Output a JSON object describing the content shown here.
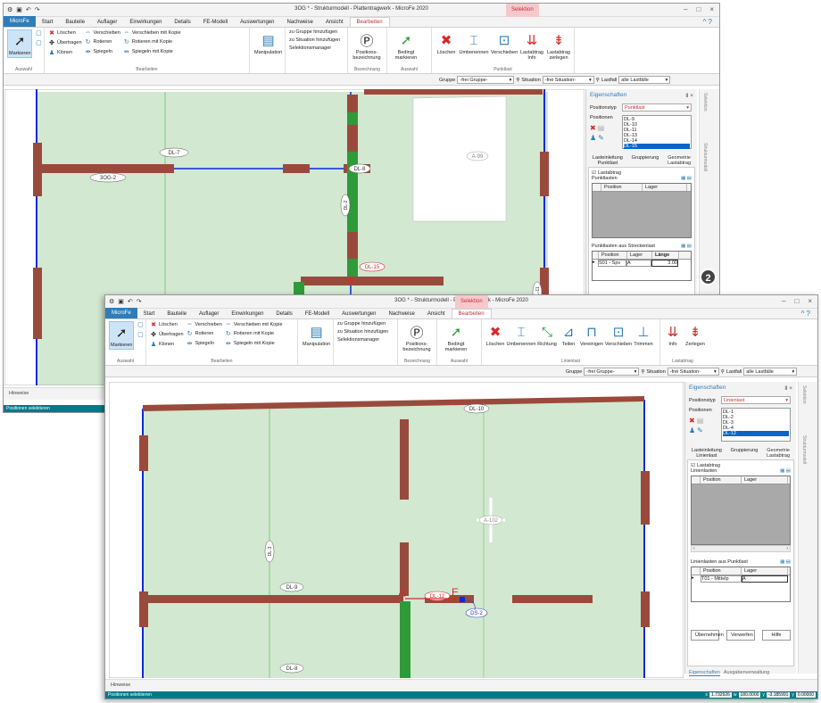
{
  "back": {
    "title": "3OG * - Strukturmodell - Plattentragwerk - MicroFe 2020",
    "context_tab": "Selektion",
    "tabs": [
      "MicroFe",
      "Start",
      "Bauteile",
      "Auflager",
      "Einwirkungen",
      "Details",
      "FE-Modell",
      "Auswertungen",
      "Nachweise",
      "Ansicht",
      "Bearbeiten"
    ],
    "ribbon": {
      "markieren": "Markieren",
      "auswahl": "Auswahl",
      "loeschen": "Löschen",
      "uebertragen": "Übertragen",
      "klonen": "Klonen",
      "verschieben": "Verschieben",
      "rotieren": "Rotieren",
      "spiegeln": "Spiegeln",
      "verschieben_kopie": "Verschieben mit Kopie",
      "rotieren_kopie": "Rotieren mit Kopie",
      "spiegeln_kopie": "Spiegeln mit Kopie",
      "bearbeiten": "Bearbeiten",
      "manipulation": "Manipulation",
      "gruppe": "zu Gruppe hinzufügen",
      "situation": "zu Situation hinzufügen",
      "selmanager": "Selektionsmanager",
      "posbez": "Positions-\nbezeichnung",
      "bezeichnung": "Bezeichnung",
      "bedingt": "Bedingt\nmarkieren",
      "auswahl2": "Auswahl",
      "loeschen2": "Löschen",
      "umbenennen": "Umbenennen",
      "verschieben2": "Verschieben",
      "lastabtrag_info": "Lastabtrag\nInfo",
      "lastabtrag_zerlegen": "Lastabtrag\nzerlegen",
      "punktlast": "Punktlast"
    },
    "filter": {
      "gruppe_label": "Gruppe",
      "gruppe": "-frei Gruppe-",
      "situation_label": "Situation",
      "situation": "-frei Situation-",
      "lastfall_label": "Lastfall",
      "lastfall": "alle Lastfälle"
    },
    "panel": {
      "title": "Eigenschaften",
      "pin": "Ⅱ ×",
      "positionstyp_label": "Positionstyp",
      "positionstyp": "Punktlast",
      "positionen_label": "Positionen",
      "positionen": [
        "DL-9",
        "DL-10",
        "DL-11",
        "DL-13",
        "DL-14",
        "DL-15"
      ],
      "selected_index": 5,
      "subtabs": [
        "Lasteinleitung\nPunktlast",
        "Gruppierung",
        "Geometrie\nLastabtrag"
      ],
      "lastabtrag_check": "Lastabtrag",
      "grid_label": "Punktlasten",
      "col_position": "Position",
      "col_lager": "Lager",
      "strecken_label": "Punktlasten aus Streckenlast",
      "col_laenge": "Länge",
      "row_position": "S01 - Spv",
      "row_lager": "A",
      "row_laenge": "3.00"
    },
    "sidebar": [
      "Selektion",
      "Strukturmodell"
    ],
    "hinweise": "Hinweise",
    "status": "Positionen selektieren",
    "canvas_labels": [
      "DL-7",
      "3OG-2",
      "DL-8",
      "DL-15",
      "DL-2",
      "A-99",
      "DL-11"
    ]
  },
  "front": {
    "title": "3OG * - Strukturmodell - Plattentragwerk - MicroFe 2020",
    "context_tab": "Selektion",
    "tabs": [
      "MicroFe",
      "Start",
      "Bauteile",
      "Auflager",
      "Einwirkungen",
      "Details",
      "FE-Modell",
      "Auswertungen",
      "Nachweise",
      "Ansicht",
      "Bearbeiten"
    ],
    "ribbon": {
      "markieren": "Markieren",
      "auswahl": "Auswahl",
      "loeschen": "Löschen",
      "uebertragen": "Übertragen",
      "klonen": "Klonen",
      "verschieben": "Verschieben",
      "rotieren": "Rotieren",
      "spiegeln": "Spiegeln",
      "verschieben_kopie": "Verschieben mit Kopie",
      "rotieren_kopie": "Rotieren mit Kopie",
      "spiegeln_kopie": "Spiegeln mit Kopie",
      "bearbeiten": "Bearbeiten",
      "manipulation": "Manipulation",
      "gruppe": "zu Gruppe hinzufügen",
      "situation": "zu Situation hinzufügen",
      "selmanager": "Selektionsmanager",
      "posbez": "Positions-\nbezeichnung",
      "bezeichnung": "Bezeichnung",
      "bedingt": "Bedingt\nmarkieren",
      "auswahl2": "Auswahl",
      "loeschen2": "Löschen",
      "umbenennen": "Umbenennen",
      "richtung": "Richtung",
      "teilen": "Teilen",
      "vereinigen": "Vereinigen",
      "verschieben2": "Verschieben",
      "trimmen": "Trimmen",
      "linienlast": "Linienlast",
      "info": "Info",
      "zerlegen": "Zerlegen",
      "lastabtrag": "Lastabtrag"
    },
    "filter": {
      "gruppe_label": "Gruppe",
      "gruppe": "-frei Gruppe-",
      "situation_label": "Situation",
      "situation": "-frei Situation-",
      "lastfall_label": "Lastfall",
      "lastfall": "alle Lastfälle"
    },
    "panel": {
      "title": "Eigenschaften",
      "pin": "Ⅱ ×",
      "positionstyp_label": "Positionstyp",
      "positionstyp": "Linienlast",
      "positionen_label": "Positionen",
      "positionen": [
        "DL-1",
        "DL-2",
        "DL-3",
        "DL-4",
        "DL-12"
      ],
      "selected_index": 4,
      "subtabs": [
        "Lasteinleitung\nLinienlast",
        "Gruppierung",
        "Geometrie\nLastabtrag"
      ],
      "lastabtrag_check": "Lastabtrag",
      "grid_label": "Linienlasten",
      "col_position": "Position",
      "col_lager": "Lager",
      "punkt_label": "Linienlasten aus Punktlast",
      "row_position": "T01 - Mittelp",
      "row_lager": "A",
      "btn_uebernehmen": "Übernehmen",
      "btn_verwerfen": "Verwerfen",
      "btn_hilfe": "Hilfe",
      "bottom_tabs": [
        "Eigenschaften",
        "Ausgabenverwaltung"
      ]
    },
    "sidebar": [
      "Selektion",
      "Strukturmodell"
    ],
    "hinweise": "Hinweise",
    "status": "Positionen selektieren",
    "coords": {
      "x_label": "x",
      "x": "1.732926",
      "w_label": "w",
      "w": "180.0000",
      "y_label": "y",
      "y": "-3.185991",
      "z_label": "y",
      "z": "0.00000"
    },
    "canvas_labels": {
      "dl10": "DL-10",
      "dl3": "DL-3",
      "dl9": "DL-9",
      "dl12": "DL-12",
      "dl8": "DL-8",
      "a102": "A-102",
      "ds2": "DS-2",
      "a": "A",
      "e": "E"
    }
  },
  "callout": "2",
  "colors": {
    "plate": "#d2e8d0",
    "beam": "#9a4a3c",
    "support": "#0a2ad8",
    "wall": "#2f9a3a",
    "accent": "#2f7db8",
    "status": "#007a87"
  }
}
